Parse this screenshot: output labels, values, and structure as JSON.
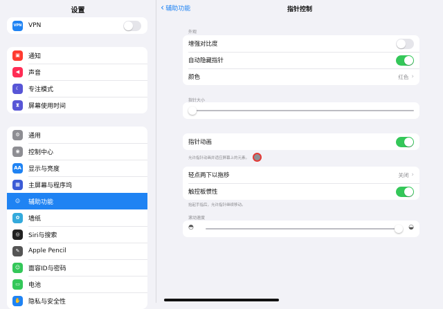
{
  "colors": {
    "accent": "#1f83f3",
    "toggle_on": "#34c759",
    "cursor_dot": "#8e8e93",
    "cursor_ring": "#e53935"
  },
  "sidebar": {
    "title": "设置",
    "vpn": {
      "icon_text": "VPN",
      "label": "VPN",
      "toggle": "off"
    },
    "group2": [
      {
        "label": "通知",
        "icon": "bell-icon",
        "color": "#ff3b30",
        "glyph": "▣"
      },
      {
        "label": "声音",
        "icon": "speaker-icon",
        "color": "#ff2d55",
        "glyph": "◀"
      },
      {
        "label": "专注模式",
        "icon": "moon-icon",
        "color": "#5856d6",
        "glyph": "☾"
      },
      {
        "label": "屏幕使用时间",
        "icon": "hourglass-icon",
        "color": "#5856d6",
        "glyph": "⧗"
      }
    ],
    "group3": [
      {
        "label": "通用",
        "icon": "gear-icon",
        "color": "#8e8e93",
        "glyph": "⚙"
      },
      {
        "label": "控制中心",
        "icon": "control-center-icon",
        "color": "#8e8e93",
        "glyph": "◉"
      },
      {
        "label": "显示与亮度",
        "icon": "display-icon",
        "color": "#1f83f3",
        "glyph": "AA"
      },
      {
        "label": "主屏幕与程序坞",
        "icon": "home-screen-icon",
        "color": "#3c5bd6",
        "glyph": "▦"
      },
      {
        "label": "辅助功能",
        "icon": "accessibility-icon",
        "color": "#1f83f3",
        "glyph": "☺",
        "selected": true
      },
      {
        "label": "墙纸",
        "icon": "wallpaper-icon",
        "color": "#34aadc",
        "glyph": "✿"
      },
      {
        "label": "Siri与搜索",
        "icon": "siri-icon",
        "color": "#222222",
        "glyph": "◎"
      },
      {
        "label": "Apple Pencil",
        "icon": "pencil-icon",
        "color": "#555555",
        "glyph": "✎"
      },
      {
        "label": "面容ID与密码",
        "icon": "face-id-icon",
        "color": "#34c759",
        "glyph": "☺"
      },
      {
        "label": "电池",
        "icon": "battery-icon",
        "color": "#34c759",
        "glyph": "▭"
      },
      {
        "label": "隐私与安全性",
        "icon": "hand-icon",
        "color": "#1f83f3",
        "glyph": "✋"
      }
    ]
  },
  "main": {
    "back_label": "辅助功能",
    "title": "指针控制",
    "appearance_label": "外观",
    "appearance": {
      "contrast": {
        "label": "增强对比度",
        "toggle": "off"
      },
      "autohide": {
        "label": "自动隐藏指针",
        "toggle": "on"
      },
      "color": {
        "label": "颜色",
        "value": "红色"
      }
    },
    "size_label": "指针大小",
    "size_value": 0.0,
    "animation": {
      "label": "指针动画",
      "toggle": "on"
    },
    "animation_note": "允许指针动画并适应屏幕上的元素。",
    "tap_drag": {
      "label": "轻点两下以拖移",
      "value": "关闭"
    },
    "trackpad_inertia": {
      "label": "触控板惯性",
      "toggle": "on"
    },
    "inertia_note": "抬起手指后，允许指针继续移动。",
    "scroll_label": "滚动速度",
    "scroll_value": 1.0
  }
}
